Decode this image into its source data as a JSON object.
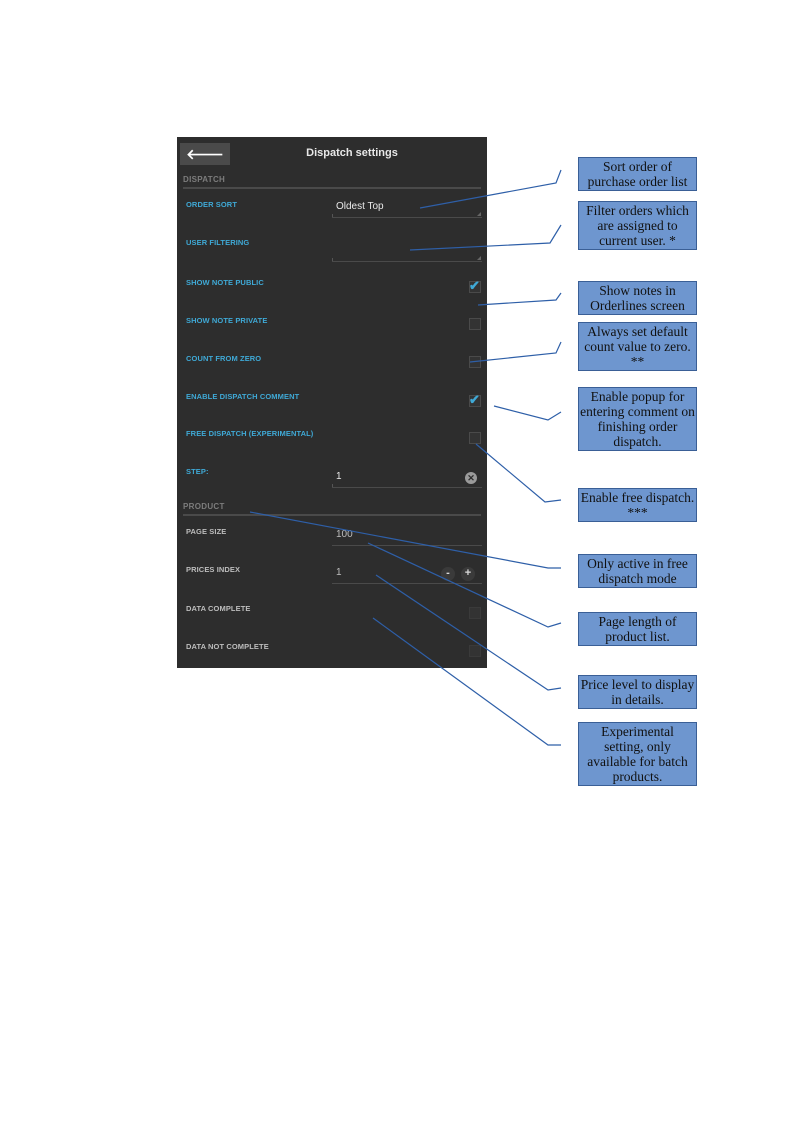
{
  "header": {
    "back_label": "🡐",
    "title": "Dispatch settings"
  },
  "sections": {
    "dispatch": "DISPATCH",
    "product": "PRODUCT"
  },
  "dispatch": {
    "order_sort": {
      "label": "ORDER SORT",
      "value": "Oldest Top"
    },
    "user_filtering": {
      "label": "USER FILTERING",
      "value": ""
    },
    "show_note_public": {
      "label": "SHOW NOTE PUBLIC",
      "checked": true
    },
    "show_note_private": {
      "label": "SHOW NOTE PRIVATE",
      "checked": false
    },
    "count_from_zero": {
      "label": "COUNT FROM ZERO",
      "checked": false
    },
    "enable_dispatch_comment": {
      "label": "ENABLE DISPATCH COMMENT",
      "checked": true
    },
    "free_dispatch": {
      "label": "FREE DISPATCH (EXPERIMENTAL)",
      "checked": false
    },
    "step": {
      "label": "STEP:",
      "value": "1",
      "clear_icon": "✕"
    }
  },
  "product": {
    "page_size": {
      "label": "PAGE SIZE",
      "value": "100"
    },
    "prices_index": {
      "label": "PRICES INDEX",
      "value": "1",
      "minus": "-",
      "plus": "+"
    },
    "data_complete": {
      "label": "DATA COMPLETE",
      "checked": false
    },
    "data_not_complete": {
      "label": "DATA NOT COMPLETE",
      "checked": false
    }
  },
  "check_glyph": "✔",
  "annotations": [
    "Sort order of purchase order list",
    "Filter orders which are assigned to current user. *",
    "Show notes in Orderlines screen",
    "Always set default count value to zero. **",
    "Enable popup for entering comment on finishing order dispatch.",
    "Enable free dispatch. ***",
    "Only active in free dispatch mode",
    "Page length of product list.",
    "Price level to display in details.",
    "Experimental setting, only available for batch products."
  ]
}
